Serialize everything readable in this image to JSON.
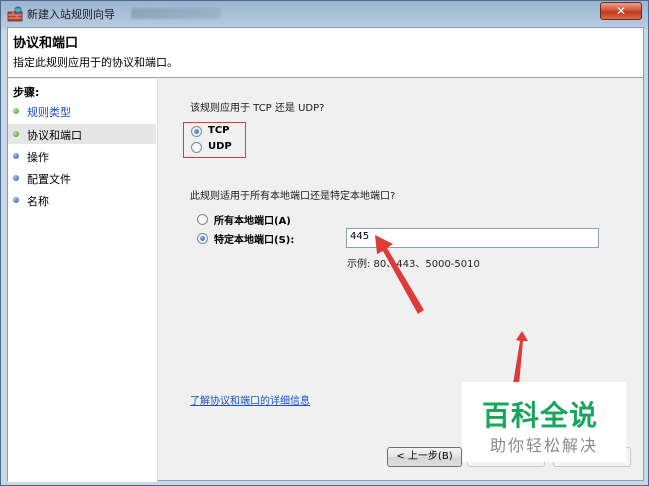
{
  "window": {
    "title": "新建入站规则向导",
    "close_glyph": "✕"
  },
  "header": {
    "title": "协议和端口",
    "subtitle": "指定此规则应用于的协议和端口。"
  },
  "sidebar": {
    "steps_label": "步骤:",
    "items": [
      {
        "label": "规则类型",
        "state": "done"
      },
      {
        "label": "协议和端口",
        "state": "current"
      },
      {
        "label": "操作",
        "state": "pending"
      },
      {
        "label": "配置文件",
        "state": "pending"
      },
      {
        "label": "名称",
        "state": "pending"
      }
    ]
  },
  "protocol": {
    "question": "该规则应用于 TCP 还是 UDP?",
    "options": [
      {
        "label": "TCP",
        "checked": true
      },
      {
        "label": "UDP",
        "checked": false
      }
    ]
  },
  "ports": {
    "question": "此规则适用于所有本地端口还是特定本地端口?",
    "options": [
      {
        "label": "所有本地端口(A)",
        "checked": false
      },
      {
        "label": "特定本地端口(S):",
        "checked": true
      }
    ],
    "value": "445",
    "example": "示例: 80、443、5000-5010"
  },
  "link_text": "了解协议和端口的详细信息",
  "buttons": {
    "back": "< 上一步(B)"
  },
  "watermark": {
    "main": "百科全说",
    "sub": "助你轻松解决"
  },
  "colors": {
    "accent_red": "#e0393a",
    "link_blue": "#1a4fcf",
    "watermark_green": "#1aa55c"
  }
}
